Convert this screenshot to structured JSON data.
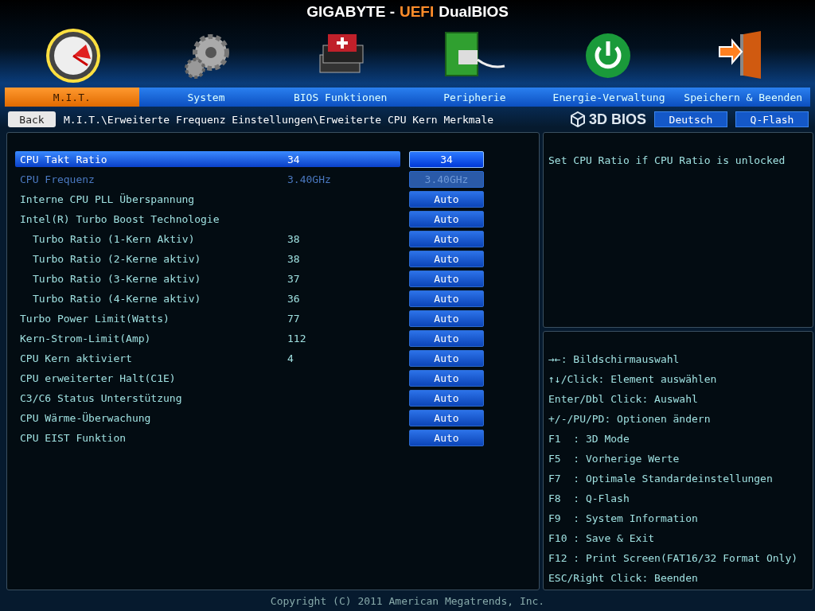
{
  "title": {
    "prefix": "GIGABYTE -",
    "highlight": "UEFI",
    "suffix": "DualBIOS"
  },
  "tabs": [
    {
      "label": "M.I.T.",
      "selected": true
    },
    {
      "label": "System",
      "selected": false
    },
    {
      "label": "BIOS Funktionen",
      "selected": false
    },
    {
      "label": "Peripherie",
      "selected": false
    },
    {
      "label": "Energie-Verwaltung",
      "selected": false
    },
    {
      "label": "Speichern & Beenden",
      "selected": false
    }
  ],
  "nav": {
    "back": "Back",
    "breadcrumb": "M.I.T.\\Erweiterte Frequenz Einstellungen\\Erweiterte CPU Kern Merkmale",
    "logo": "3D BIOS",
    "language": "Deutsch",
    "qflash": "Q-Flash"
  },
  "settings": [
    {
      "label": "CPU Takt Ratio",
      "value": "34",
      "option": "34",
      "selected": true,
      "disabled": false
    },
    {
      "label": "CPU Frequenz",
      "value": "3.40GHz",
      "option": "3.40GHz",
      "selected": false,
      "disabled": true
    },
    {
      "label": "Interne CPU PLL Überspannung",
      "option": "Auto",
      "selected": false,
      "disabled": false
    },
    {
      "label": "Intel(R) Turbo Boost Technologie",
      "option": "Auto",
      "selected": false,
      "disabled": false,
      "children": [
        {
          "label": "Turbo Ratio (1-Kern Aktiv)",
          "value": "38",
          "option": "Auto",
          "selected": false,
          "disabled": false
        },
        {
          "label": "Turbo Ratio (2-Kerne aktiv)",
          "value": "38",
          "option": "Auto",
          "selected": false,
          "disabled": false
        },
        {
          "label": "Turbo Ratio (3-Kerne aktiv)",
          "value": "37",
          "option": "Auto",
          "selected": false,
          "disabled": false
        },
        {
          "label": "Turbo Ratio (4-Kerne aktiv)",
          "value": "36",
          "option": "Auto",
          "selected": false,
          "disabled": false
        }
      ]
    },
    {
      "label": "Turbo Power Limit(Watts)",
      "value": "77",
      "option": "Auto",
      "selected": false,
      "disabled": false
    },
    {
      "label": "Kern-Strom-Limit(Amp)",
      "value": "112",
      "option": "Auto",
      "selected": false,
      "disabled": false
    },
    {
      "label": "CPU Kern aktiviert",
      "value": "4",
      "option": "Auto",
      "selected": false,
      "disabled": false
    },
    {
      "label": "CPU erweiterter Halt(C1E)",
      "option": "Auto",
      "selected": false,
      "disabled": false
    },
    {
      "label": "C3/C6 Status Unterstützung",
      "option": "Auto",
      "selected": false,
      "disabled": false
    },
    {
      "label": "CPU Wärme-Überwachung",
      "option": "Auto",
      "selected": false,
      "disabled": false
    },
    {
      "label": "CPU EIST Funktion",
      "option": "Auto",
      "selected": false,
      "disabled": false
    }
  ],
  "description": "Set CPU Ratio if CPU Ratio is unlocked",
  "help": [
    "→←: Bildschirmauswahl",
    "↑↓/Click: Element auswählen",
    "Enter/Dbl Click: Auswahl",
    "+/-/PU/PD: Optionen ändern",
    "F1  : 3D Mode",
    "F5  : Vorherige Werte",
    "F7  : Optimale Standardeinstellungen",
    "F8  : Q-Flash",
    "F9  : System Information",
    "F10 : Save & Exit",
    "F12 : Print Screen(FAT16/32 Format Only)",
    "ESC/Right Click: Beenden"
  ],
  "copyright": "Copyright (C) 2011 American Megatrends, Inc."
}
